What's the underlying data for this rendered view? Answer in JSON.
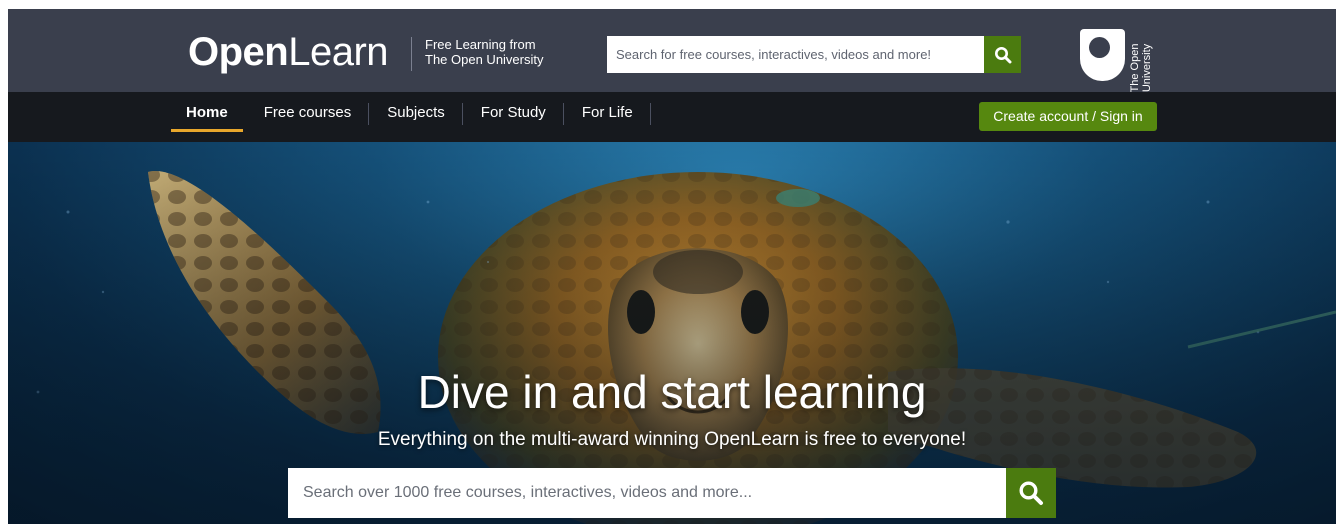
{
  "header": {
    "logo_bold": "Open",
    "logo_light": "Learn",
    "tagline_line1": "Free Learning from",
    "tagline_line2": "The Open University",
    "search_placeholder": "Search for free courses, interactives, videos and more!",
    "search_icon": "search-icon",
    "ou_logo_line1": "The Open",
    "ou_logo_line2": "University"
  },
  "nav": {
    "items": [
      {
        "label": "Home",
        "active": true
      },
      {
        "label": "Free courses",
        "active": false
      },
      {
        "label": "Subjects",
        "active": false
      },
      {
        "label": "For Study",
        "active": false
      },
      {
        "label": "For Life",
        "active": false
      }
    ],
    "cta_label": "Create account / Sign in"
  },
  "hero": {
    "title": "Dive in and start learning",
    "subtitle": "Everything on the multi-award winning OpenLearn is free to everyone!",
    "search_placeholder": "Search over 1000 free courses, interactives, videos and more...",
    "search_icon": "search-icon"
  },
  "colors": {
    "header_bg": "#3a3f4d",
    "nav_bg": "#16191e",
    "accent_green": "#56880f",
    "search_button_green": "#4b7b0f",
    "active_underline": "#e8a72c"
  }
}
